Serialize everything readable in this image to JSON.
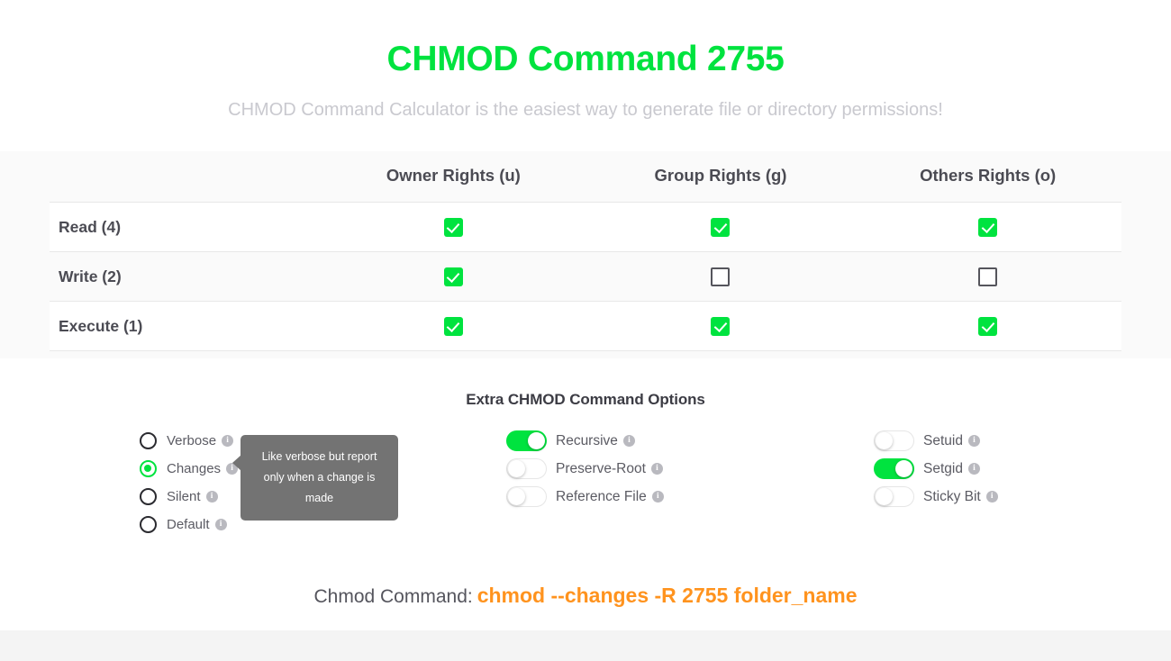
{
  "header": {
    "title": "CHMOD Command 2755",
    "subtitle": "CHMOD Command Calculator is the easiest way to generate file or directory permissions!"
  },
  "colors": {
    "accent_green": "#00e33f",
    "command_orange": "#ff931e",
    "tooltip_gray": "#737373",
    "text_dark": "#4b4b53"
  },
  "permissions_table": {
    "columns": [
      "",
      "Owner Rights (u)",
      "Group Rights (g)",
      "Others Rights (o)"
    ],
    "rows": [
      {
        "label": "Read (4)",
        "owner": true,
        "group": true,
        "others": true
      },
      {
        "label": "Write (2)",
        "owner": true,
        "group": false,
        "others": false
      },
      {
        "label": "Execute (1)",
        "owner": true,
        "group": true,
        "others": true
      }
    ]
  },
  "options": {
    "title": "Extra CHMOD Command Options",
    "verbosity_radios": [
      {
        "label": "Verbose",
        "selected": false,
        "info": "info-icon"
      },
      {
        "label": "Changes",
        "selected": true,
        "info": "info-icon"
      },
      {
        "label": "Silent",
        "selected": false,
        "info": "info-icon"
      },
      {
        "label": "Default",
        "selected": false,
        "info": "info-icon"
      }
    ],
    "middle_toggles": [
      {
        "label": "Recursive",
        "on": true,
        "info": "info-icon"
      },
      {
        "label": "Preserve-Root",
        "on": false,
        "info": "info-icon"
      },
      {
        "label": "Reference File",
        "on": false,
        "info": "info-icon"
      }
    ],
    "right_toggles": [
      {
        "label": "Setuid",
        "on": false,
        "info": "info-icon"
      },
      {
        "label": "Setgid",
        "on": true,
        "info": "info-icon"
      },
      {
        "label": "Sticky Bit",
        "on": false,
        "info": "info-icon"
      }
    ]
  },
  "tooltip": {
    "text": "Like verbose but report only when a change is made"
  },
  "command": {
    "label": "Chmod Command:",
    "value": "chmod --changes -R 2755 folder_name"
  },
  "icons": {
    "info": "i",
    "check": "check-icon"
  }
}
